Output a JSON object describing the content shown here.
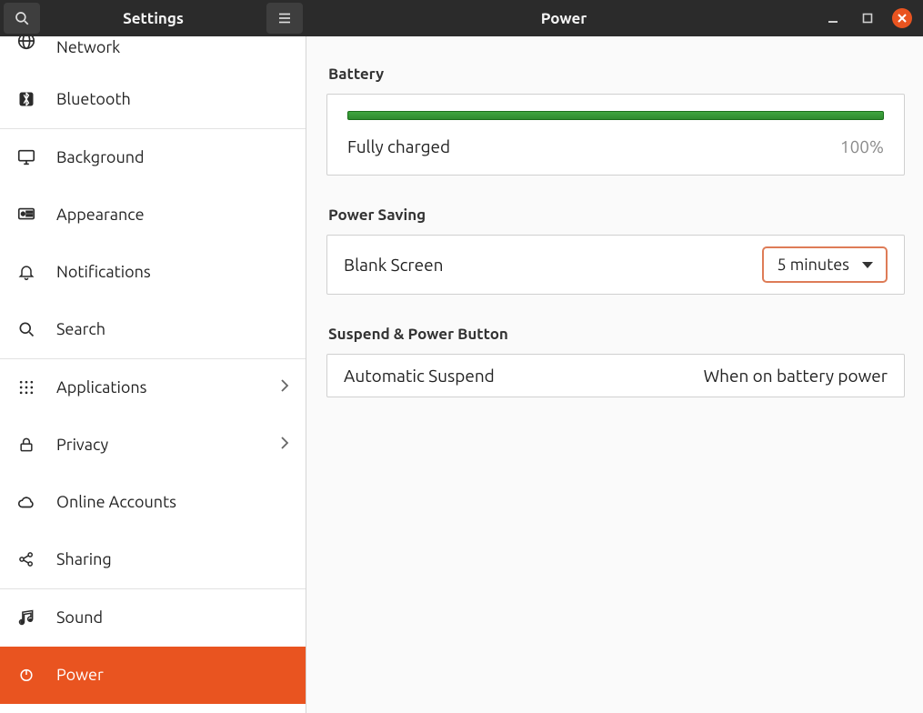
{
  "header": {
    "settings_title": "Settings",
    "page_title": "Power"
  },
  "sidebar": {
    "items": [
      {
        "id": "network",
        "label": "Network",
        "icon": "globe",
        "chevron": false
      },
      {
        "id": "bluetooth",
        "label": "Bluetooth",
        "icon": "bluetooth",
        "chevron": false
      },
      {
        "id": "background",
        "label": "Background",
        "icon": "monitor",
        "chevron": false
      },
      {
        "id": "appearance",
        "label": "Appearance",
        "icon": "appearance",
        "chevron": false
      },
      {
        "id": "notifications",
        "label": "Notifications",
        "icon": "bell",
        "chevron": false
      },
      {
        "id": "search",
        "label": "Search",
        "icon": "search",
        "chevron": false
      },
      {
        "id": "applications",
        "label": "Applications",
        "icon": "grid",
        "chevron": true
      },
      {
        "id": "privacy",
        "label": "Privacy",
        "icon": "lock",
        "chevron": true
      },
      {
        "id": "onlineaccounts",
        "label": "Online Accounts",
        "icon": "cloud",
        "chevron": false
      },
      {
        "id": "sharing",
        "label": "Sharing",
        "icon": "share",
        "chevron": false
      },
      {
        "id": "sound",
        "label": "Sound",
        "icon": "music",
        "chevron": false
      },
      {
        "id": "power",
        "label": "Power",
        "icon": "power",
        "chevron": false,
        "selected": true
      }
    ]
  },
  "sections": {
    "battery": {
      "title": "Battery",
      "status": "Fully charged",
      "percent_text": "100%",
      "percent": 100
    },
    "power_saving": {
      "title": "Power Saving",
      "blank_screen_label": "Blank Screen",
      "blank_screen_value": "5 minutes"
    },
    "suspend": {
      "title": "Suspend & Power Button",
      "auto_suspend_label": "Automatic Suspend",
      "auto_suspend_value": "When on battery power"
    }
  }
}
